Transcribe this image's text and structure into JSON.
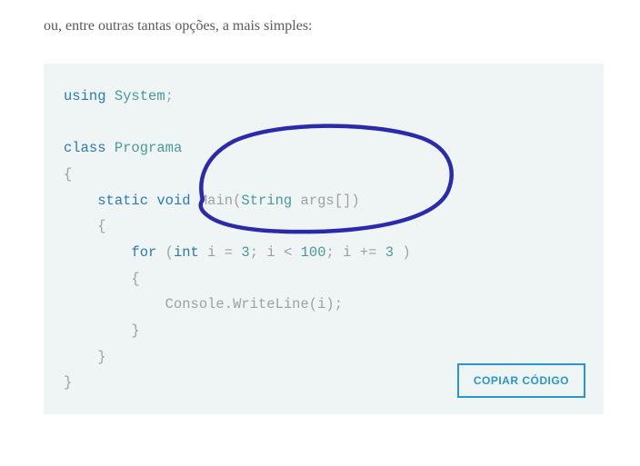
{
  "intro": "ou, entre outras tantas opções, a mais simples:",
  "code": {
    "line1_kw": "using",
    "line1_ns": "System",
    "line1_semi": ";",
    "line2_kw": "class",
    "line2_name": "Programa",
    "brace_open": "{",
    "brace_close": "}",
    "line3_static": "static",
    "line3_void": "void",
    "line3_main": "Main",
    "line3_paren_open": "(",
    "line3_string": "String",
    "line3_args": "args",
    "line3_brackets": "[]",
    "line3_paren_close": ")",
    "line4_for": "for",
    "line4_paren_open": "(",
    "line4_int": "int",
    "line4_i1": "i",
    "line4_eq": "=",
    "line4_v1": "3",
    "line4_semi1": ";",
    "line4_i2": "i",
    "line4_lt": "<",
    "line4_v2": "100",
    "line4_semi2": ";",
    "line4_i3": "i",
    "line4_pluseq": "+=",
    "line4_v3": "3",
    "line4_paren_close": ")",
    "line5_console": "Console",
    "line5_dot": ".",
    "line5_writeline": "WriteLine",
    "line5_paren_open": "(",
    "line5_i": "i",
    "line5_paren_close": ")",
    "line5_semi": ";"
  },
  "copy_button": "COPIAR CÓDIGO"
}
